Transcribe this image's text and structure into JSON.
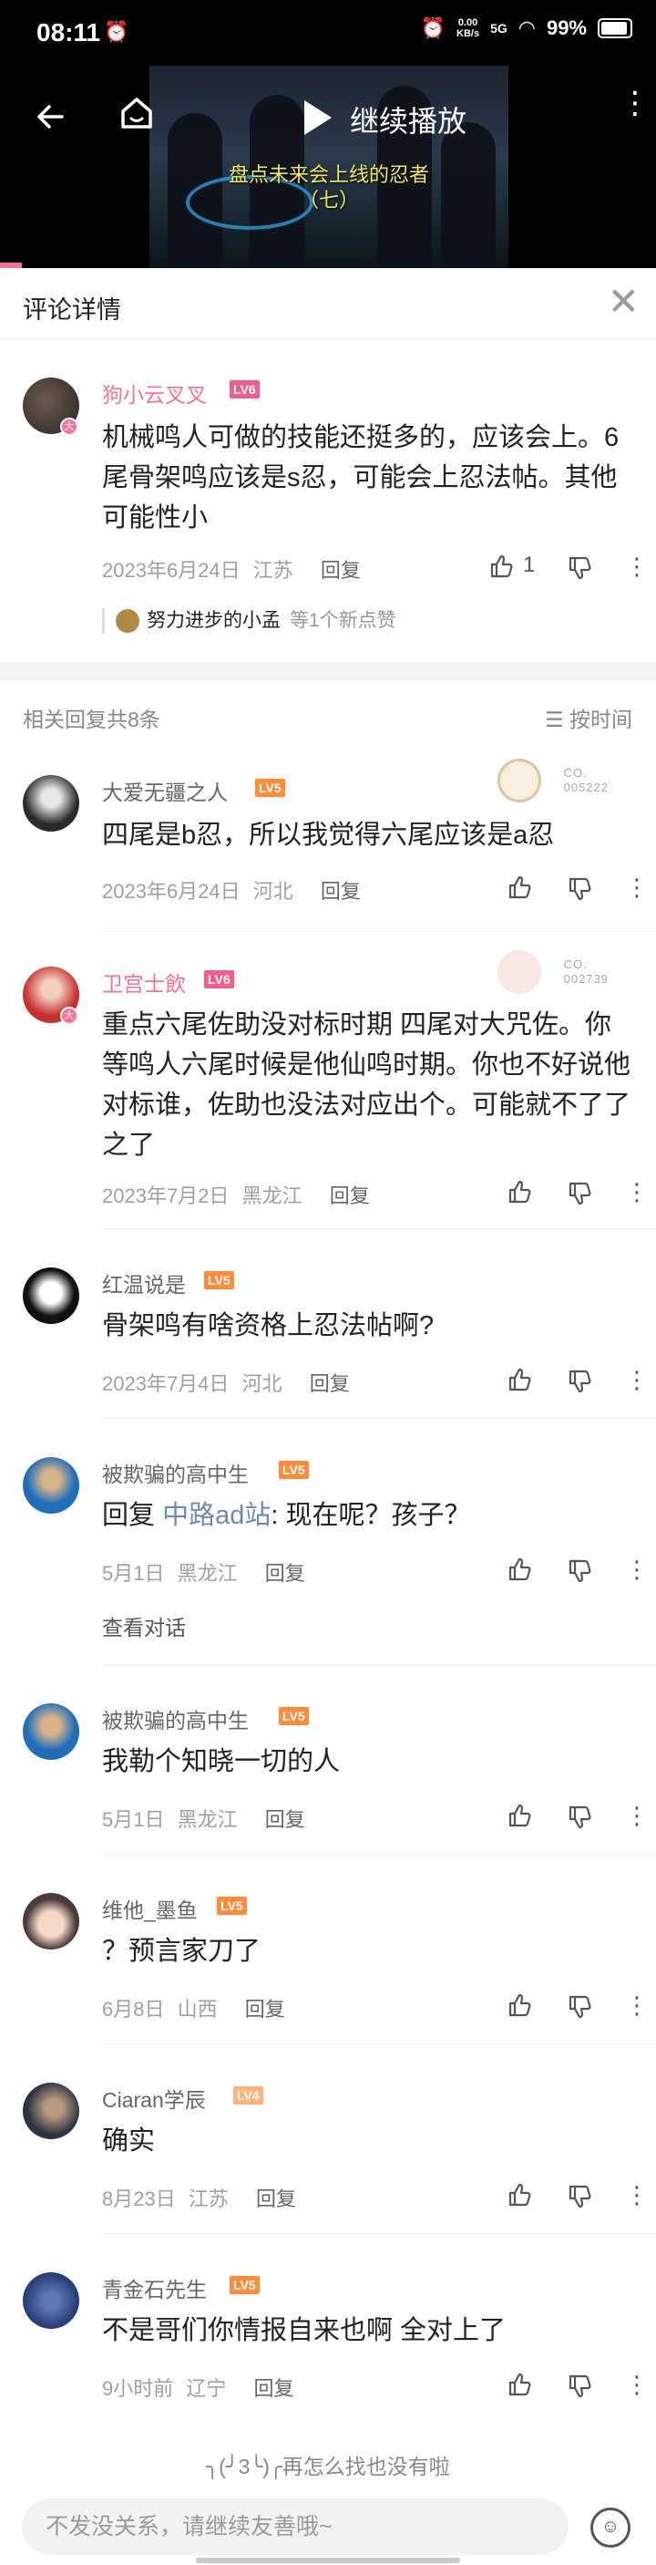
{
  "status_bar": {
    "time": "08:11",
    "net_speed": "0.00\nKB/s",
    "signal": "5G",
    "battery": "99%"
  },
  "video": {
    "continue_label": "继续播放",
    "caption_line1": "盘点未来会上线的忍者",
    "caption_line2": "（七）"
  },
  "detail": {
    "title": "评论详情"
  },
  "main_comment": {
    "user": "狗小云叉叉",
    "level": "LV6",
    "text": "机械鸣人可做的技能还挺多的，应该会上。6尾骨架鸣应该是s忍，可能会上忍法帖。其他可能性小",
    "date": "2023年6月24日",
    "location": "江苏",
    "reply_label": "回复",
    "likes": "1",
    "liked_by": "努力进步的小孟",
    "liked_rest": "等1个新点赞"
  },
  "replies_header": {
    "count": "相关回复共8条",
    "sort": "按时间"
  },
  "replies": [
    {
      "user": "大爱无疆之人",
      "level": "LV5",
      "fan_no": "CO.\n005222",
      "text": "四尾是b忍，所以我觉得六尾应该是a忍",
      "date": "2023年6月24日",
      "location": "河北",
      "reply_label": "回复"
    },
    {
      "user": "卫宫士飲",
      "level": "LV6",
      "fan_no": "CO.\n002739",
      "text": "重点六尾佐助没对标时期 四尾对大咒佐。你等鸣人六尾时候是他仙鸣时期。你也不好说他对标谁，佐助也没法对应出个。可能就不了了之了",
      "date": "2023年7月2日",
      "location": "黑龙江",
      "reply_label": "回复"
    },
    {
      "user": "红温说是",
      "level": "LV5",
      "text": "骨架鸣有啥资格上忍法帖啊?",
      "date": "2023年7月4日",
      "location": "河北",
      "reply_label": "回复"
    },
    {
      "user": "被欺骗的高中生",
      "level": "LV5",
      "text_prefix": "回复 ",
      "text_link": "中路ad站",
      "text_rest": ": 现在呢？孩子？",
      "date": "5月1日",
      "location": "黑龙江",
      "reply_label": "回复",
      "view_conversation": "查看对话"
    },
    {
      "user": "被欺骗的高中生",
      "level": "LV5",
      "text": "我勒个知晓一切的人",
      "date": "5月1日",
      "location": "黑龙江",
      "reply_label": "回复"
    },
    {
      "user": "维他_墨鱼",
      "level": "LV5",
      "text": "？预言家刀了",
      "date": "6月8日",
      "location": "山西",
      "reply_label": "回复"
    },
    {
      "user": "Ciaran学辰",
      "level": "LV4",
      "text": "确实",
      "date": "8月23日",
      "location": "江苏",
      "reply_label": "回复"
    },
    {
      "user": "青金石先生",
      "level": "LV5",
      "text": "不是哥们你情报自来也啊 全对上了",
      "date": "9小时前",
      "location": "辽宁",
      "reply_label": "回复"
    }
  ],
  "footer": {
    "end_text": "╮(╯3╰)╭再怎么找也没有啦",
    "input_placeholder": "不发没关系，请继续友善哦~"
  },
  "colors": {
    "accent": "#fb7299",
    "lv6": "#f25d8e",
    "lv5": "#ff8c38",
    "lv4": "#ffb37c",
    "link": "#6b8bb3"
  },
  "icons": [
    "back-arrow-icon",
    "home-icon",
    "play-icon",
    "more-icon",
    "close-icon",
    "like-icon",
    "dislike-icon",
    "sort-icon",
    "emoji-icon"
  ]
}
